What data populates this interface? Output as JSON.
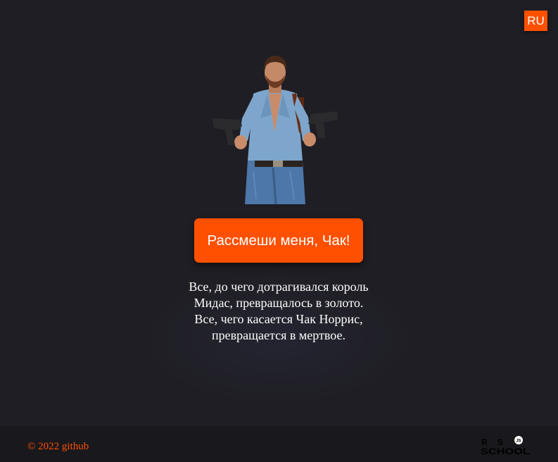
{
  "header": {
    "lang_label": "RU"
  },
  "main": {
    "joke_button_label": "Рассмеши меня, Чак!",
    "quote_lines": [
      "Все, до чего дотрагивался король",
      "Мидас, превращалось в золото.",
      "Все, чего касается Чак Норрис,",
      "превращается в мертвое."
    ]
  },
  "footer": {
    "copyright": "© 2022",
    "github_link": "github",
    "logo": {
      "row1": [
        "R",
        "S"
      ],
      "row2": "SCHOOL",
      "badge": "JS"
    }
  },
  "colors": {
    "background": "#1f1e24",
    "footer_background": "#19181d",
    "accent": "#ff5000",
    "text": "#ffffff"
  },
  "icons": {
    "lang": "language-switch",
    "hero": "chuck-norris-image",
    "logo": "rs-school-logo"
  }
}
